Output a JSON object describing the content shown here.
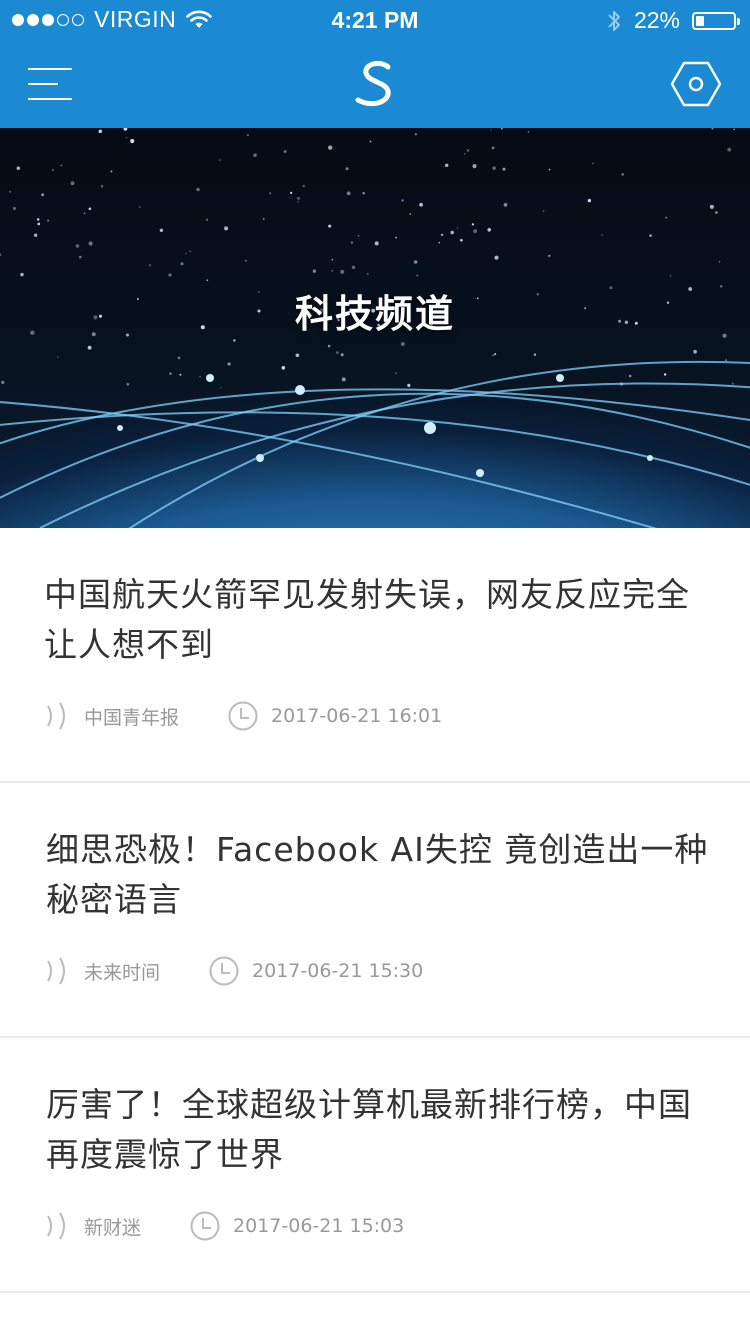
{
  "status_bar": {
    "carrier": "VIRGIN",
    "time": "4:21 PM",
    "battery_percent": "22%",
    "battery_level": 0.22,
    "signal_bars_filled": 3,
    "signal_bars_total": 5,
    "icons": [
      "wifi-icon",
      "bluetooth-icon",
      "battery-icon"
    ]
  },
  "nav": {
    "menu_icon": "menu-icon",
    "logo_icon": "s-logo-icon",
    "settings_icon": "hexagon-settings-icon",
    "accent_color": "#1b8ad2"
  },
  "hero": {
    "title": "科技频道"
  },
  "articles": [
    {
      "title": "中国航天火箭罕见发射失误，网友反应完全让人想不到",
      "source": "中国青年报",
      "time": "2017-06-21 16:01"
    },
    {
      "title": "细思恐极！Facebook AI失控 竟创造出一种秘密语言",
      "source": "未来时间",
      "time": "2017-06-21 15:30"
    },
    {
      "title": "厉害了！全球超级计算机最新排行榜，中国再度震惊了世界",
      "source": "新财迷",
      "time": "2017-06-21 15:03"
    }
  ]
}
